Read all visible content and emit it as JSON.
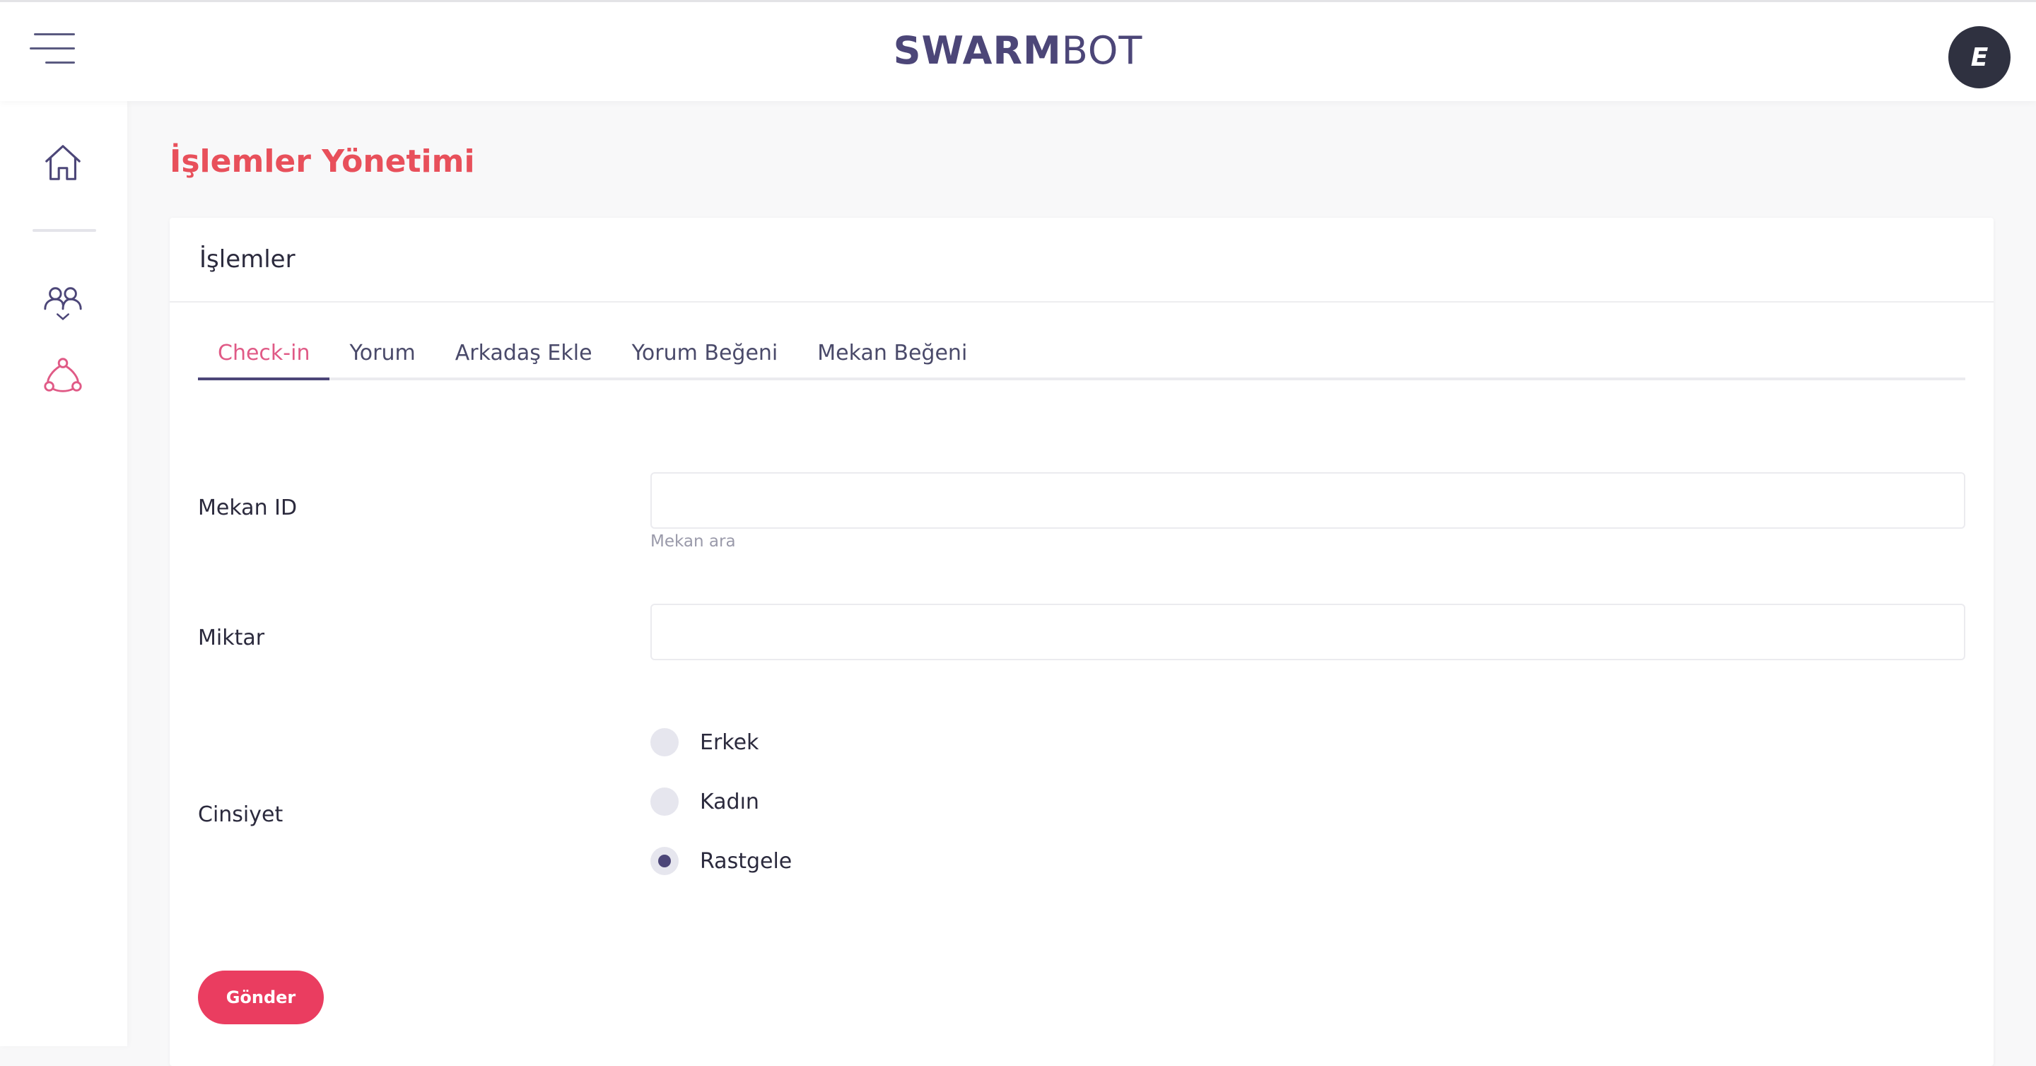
{
  "header": {
    "brand_bold": "SWARM",
    "brand_light": "BOT",
    "avatar_initial": "E",
    "menu_icon": "hamburger-menu-icon"
  },
  "sidebar": {
    "items": [
      {
        "icon": "home-icon"
      },
      {
        "icon": "users-icon",
        "expandable": true
      },
      {
        "icon": "network-icon",
        "active": true
      }
    ]
  },
  "page": {
    "title": "İşlemler Yönetimi"
  },
  "card": {
    "header": "İşlemler",
    "tabs": [
      {
        "label": "Check-in",
        "active": true
      },
      {
        "label": "Yorum"
      },
      {
        "label": "Arkadaş Ekle"
      },
      {
        "label": "Yorum Beğeni"
      },
      {
        "label": "Mekan Beğeni"
      }
    ]
  },
  "form": {
    "mekan_id": {
      "label": "Mekan ID",
      "value": "",
      "hint": "Mekan ara"
    },
    "miktar": {
      "label": "Miktar",
      "value": ""
    },
    "cinsiyet": {
      "label": "Cinsiyet",
      "options": [
        {
          "label": "Erkek",
          "selected": false
        },
        {
          "label": "Kadın",
          "selected": false
        },
        {
          "label": "Rastgele",
          "selected": true
        }
      ]
    },
    "submit_label": "Gönder"
  },
  "colors": {
    "brand": "#4c4678",
    "title": "#e8505b",
    "active_tab": "#e05a86",
    "submit": "#ea3d60",
    "avatar_bg": "#2f3140"
  }
}
